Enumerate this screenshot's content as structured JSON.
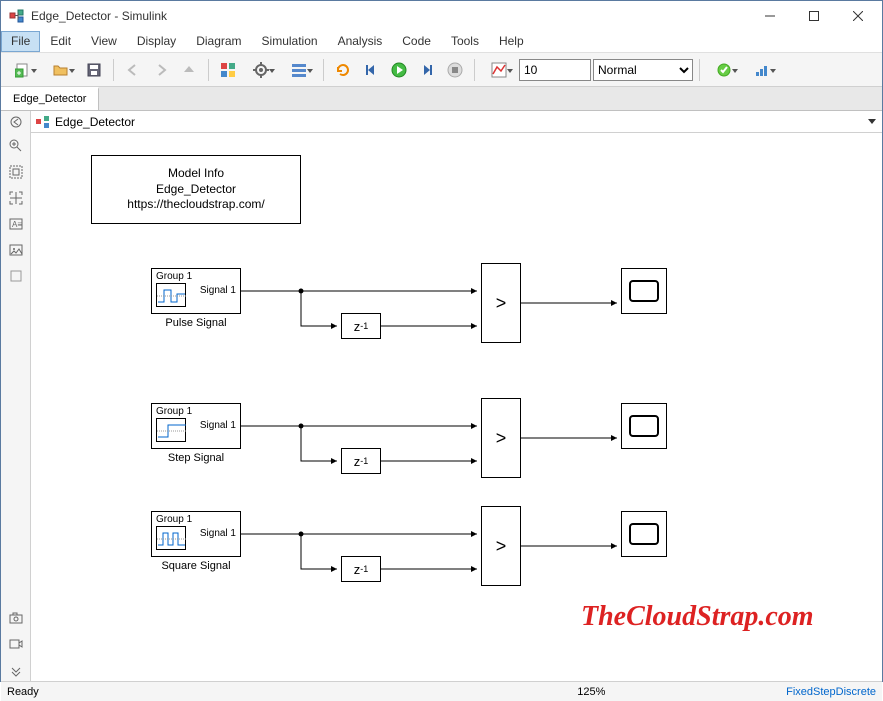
{
  "title": "Edge_Detector - Simulink",
  "menu": {
    "file": "File",
    "edit": "Edit",
    "view": "View",
    "display": "Display",
    "diagram": "Diagram",
    "simulation": "Simulation",
    "analysis": "Analysis",
    "code": "Code",
    "tools": "Tools",
    "help": "Help"
  },
  "toolbar": {
    "stop_time": "10",
    "sim_mode": "Normal"
  },
  "tab": {
    "name": "Edge_Detector"
  },
  "breadcrumb": {
    "model": "Edge_Detector"
  },
  "info_box": {
    "line1": "Model Info",
    "line2": "Edge_Detector",
    "line3": "https://thecloudstrap.com/"
  },
  "chains": [
    {
      "group": "Group 1",
      "signal": "Signal 1",
      "label": "Pulse Signal",
      "delay_text": "z",
      "delay_sup": "-1",
      "compare": ">"
    },
    {
      "group": "Group 1",
      "signal": "Signal 1",
      "label": "Step Signal",
      "delay_text": "z",
      "delay_sup": "-1",
      "compare": ">"
    },
    {
      "group": "Group 1",
      "signal": "Signal 1",
      "label": "Square Signal",
      "delay_text": "z",
      "delay_sup": "-1",
      "compare": ">"
    }
  ],
  "watermark": "TheCloudStrap.com",
  "status": {
    "left": "Ready",
    "mid": "125%",
    "right": "FixedStepDiscrete"
  }
}
